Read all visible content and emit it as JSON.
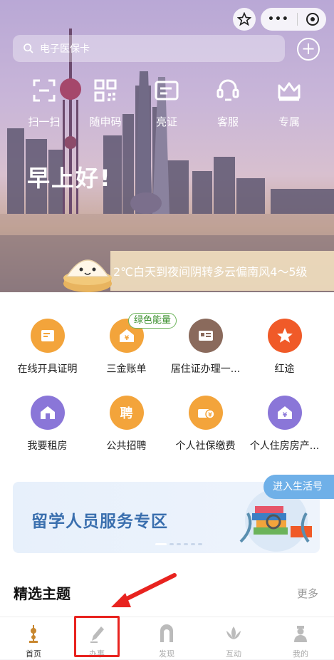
{
  "header": {
    "search_placeholder": "电子医保卡",
    "quick_actions": [
      {
        "label": "扫一扫",
        "icon": "scan-icon"
      },
      {
        "label": "随申码",
        "icon": "qr-code-icon"
      },
      {
        "label": "亮证",
        "icon": "id-card-icon"
      },
      {
        "label": "客服",
        "icon": "headset-icon"
      },
      {
        "label": "专属",
        "icon": "crown-icon"
      }
    ],
    "greeting": "早上好!",
    "weather": "2℃白天到夜间阴转多云偏南风4～5级"
  },
  "services": [
    {
      "label": "在线开具证明",
      "color": "#f3a43b"
    },
    {
      "label": "三金账单",
      "color": "#f3a43b",
      "badge": "绿色能量"
    },
    {
      "label": "居住证办理一...",
      "color": "#8a6a5c"
    },
    {
      "label": "红途",
      "color": "#f05a28"
    },
    {
      "label": "我要租房",
      "color": "#8a76d8"
    },
    {
      "label": "公共招聘",
      "color": "#f3a43b",
      "glyph": "聘"
    },
    {
      "label": "个人社保缴费",
      "color": "#f3a43b"
    },
    {
      "label": "个人住房房产...",
      "color": "#8a76d8"
    }
  ],
  "banner": {
    "title": "留学人员服务专区",
    "life_button": "进入生活号"
  },
  "featured": {
    "title": "精选主题",
    "more": "更多"
  },
  "tabbar": [
    {
      "label": "首页",
      "icon": "home-tower-icon",
      "active": true
    },
    {
      "label": "办事",
      "icon": "pen-icon",
      "active": false
    },
    {
      "label": "发现",
      "icon": "arch-icon",
      "active": false
    },
    {
      "label": "互动",
      "icon": "lotus-icon",
      "active": false
    },
    {
      "label": "我的",
      "icon": "person-icon",
      "active": false
    }
  ],
  "colors": {
    "accent_blue": "#3a6fae",
    "highlight_red": "#e8231f",
    "badge_green": "#3a8f2c"
  }
}
